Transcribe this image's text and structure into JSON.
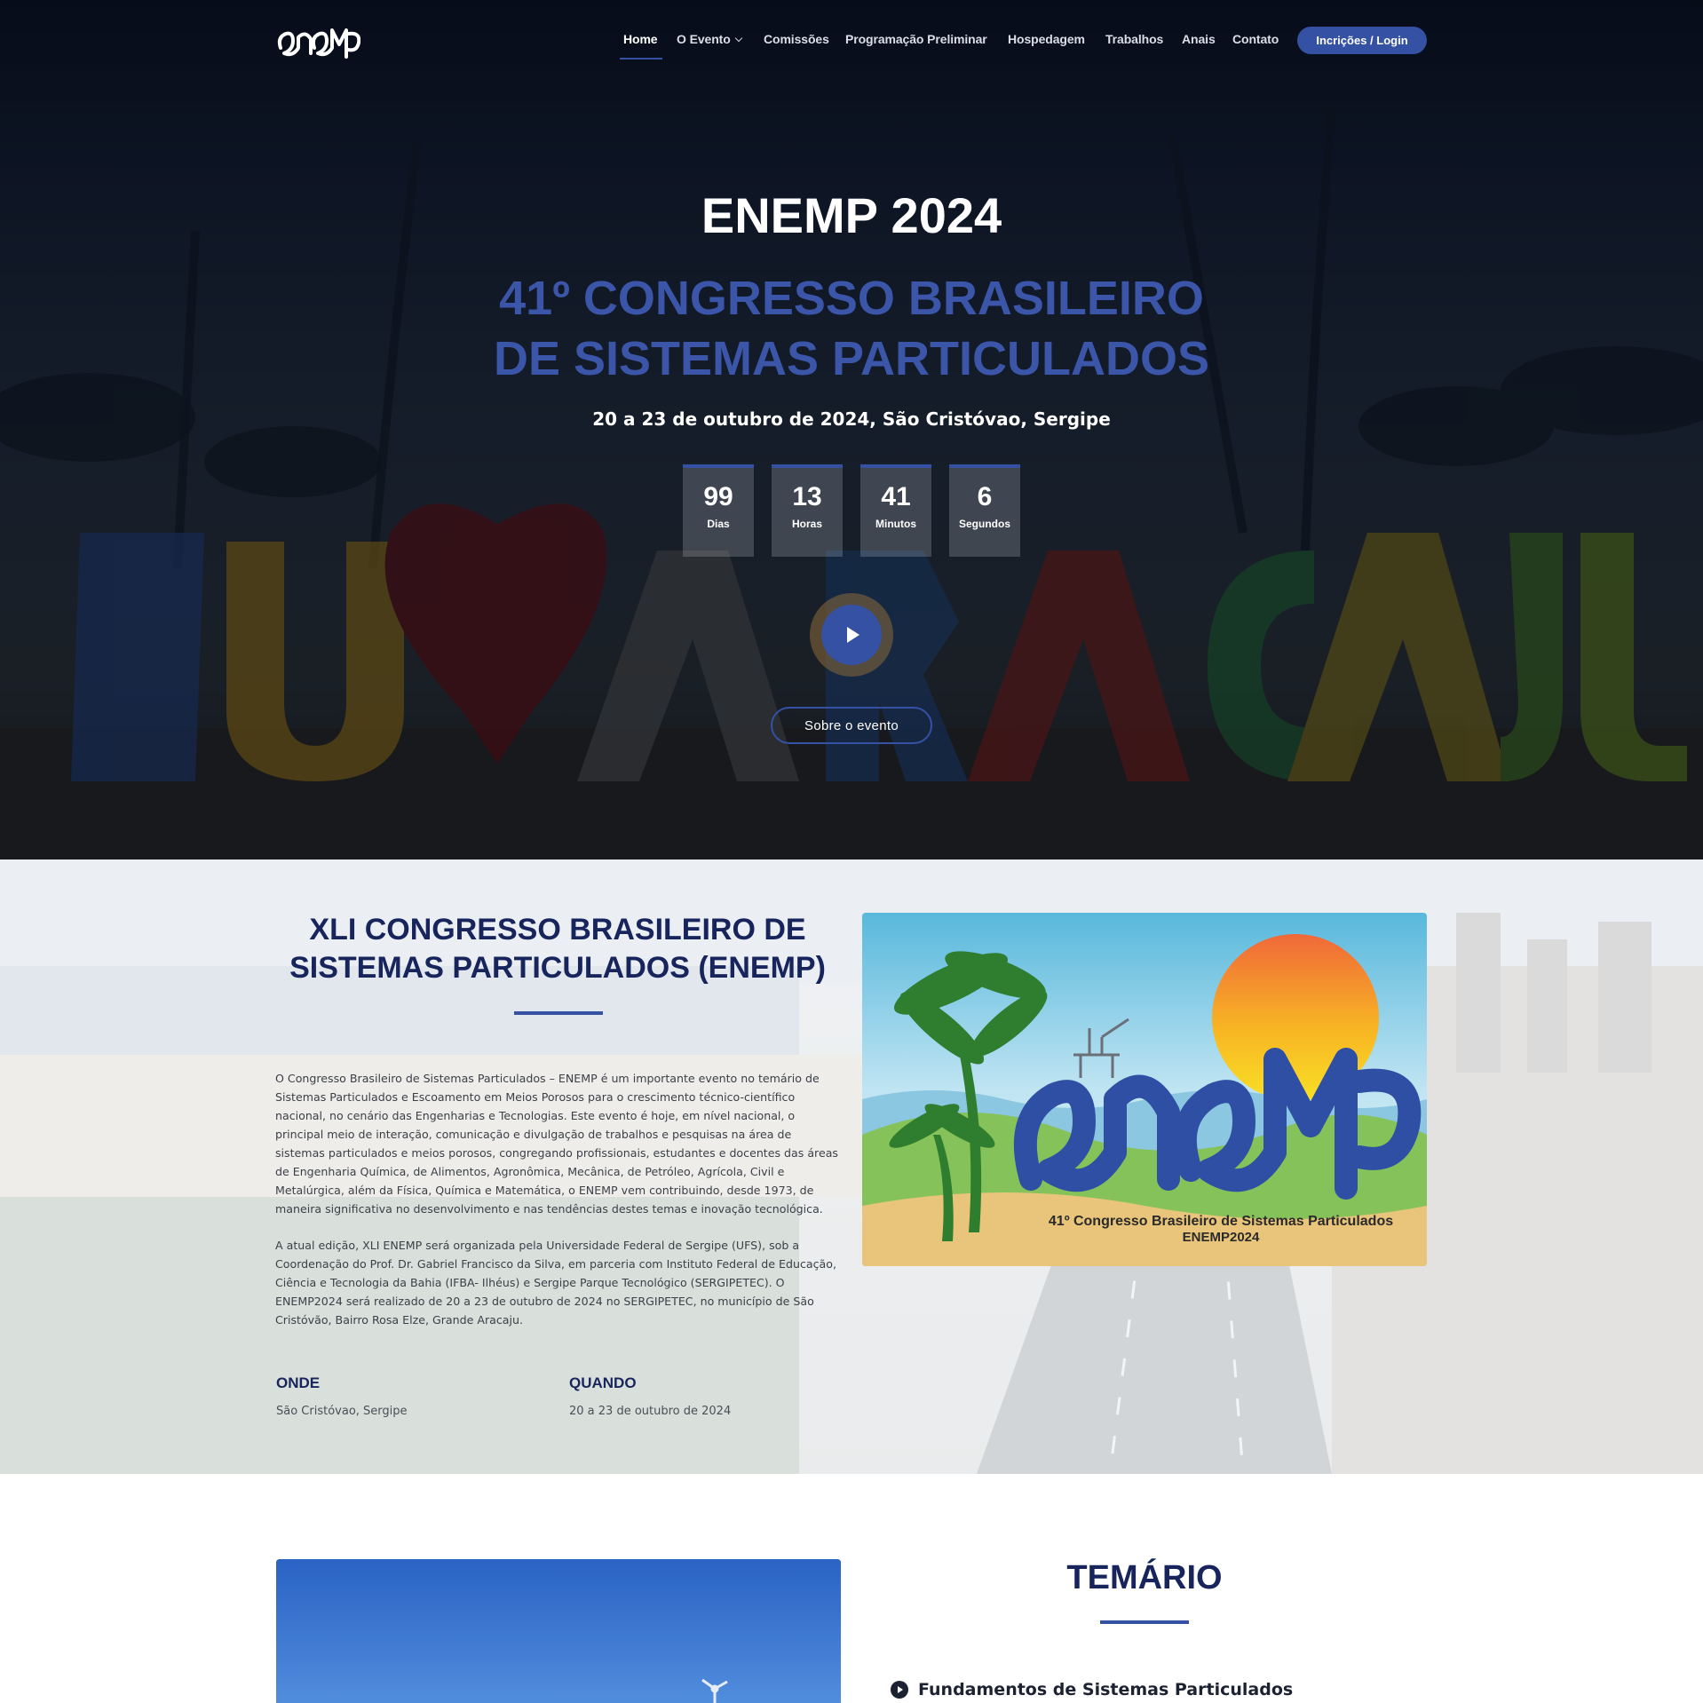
{
  "nav": {
    "logo_text": "enemp",
    "items": [
      {
        "label": "Home"
      },
      {
        "label": "O Evento"
      },
      {
        "label": "Comissões"
      },
      {
        "label": "Programação Preliminar"
      },
      {
        "label": "Hospedagem"
      },
      {
        "label": "Trabalhos"
      },
      {
        "label": "Anais"
      },
      {
        "label": "Contato"
      }
    ],
    "login_label": "Incrições / Login"
  },
  "hero": {
    "title": "ENEMP 2024",
    "subtitle_line1": "41º CONGRESSO BRASILEIRO",
    "subtitle_line2": "DE SISTEMAS PARTICULADOS",
    "date_place": "20 a 23 de outubro de 2024, São Cristóvao, Sergipe",
    "background_sign_text": "EU ARACAJU",
    "countdown": [
      {
        "value": "99",
        "label": "Dias"
      },
      {
        "value": "13",
        "label": "Horas"
      },
      {
        "value": "41",
        "label": "Minutos"
      },
      {
        "value": "6",
        "label": "Segundos"
      }
    ],
    "about_button": "Sobre o evento"
  },
  "about": {
    "heading_line1": "XLI CONGRESSO BRASILEIRO DE",
    "heading_line2": "SISTEMAS PARTICULADOS (ENEMP)",
    "paragraph1": "O Congresso Brasileiro de Sistemas Particulados – ENEMP é um importante evento no temário de Sistemas Particulados e Escoamento em Meios Porosos para o crescimento técnico-científico nacional, no cenário das Engenharias e Tecnologias. Este evento é hoje, em nível nacional, o principal meio de interação, comunicação e divulgação de trabalhos e pesquisas na área de sistemas particulados e meios porosos, congregando profissionais, estudantes e docentes das áreas de Engenharia Química, de Alimentos, Agronômica, Mecânica, de Petróleo, Agrícola, Civil e Metalúrgica, além da Física, Química e Matemática, o ENEMP vem contribuindo, desde 1973, de maneira significativa no desenvolvimento e nas tendências destes temas e inovação tecnológica.",
    "paragraph2": "A atual edição, XLI ENEMP será organizada pela Universidade Federal de Sergipe (UFS), sob a Coordenação do Prof. Dr. Gabriel Francisco da Silva, em parceria com Instituto Federal de Educação, Ciência e Tecnologia da Bahia (IFBA- Ilhéus) e Sergipe Parque Tecnológico (SERGIPETEC). O ENEMP2024 será realizado de 20 a 23 de outubro de 2024 no SERGIPETEC, no município de São Cristóvão, Bairro Rosa Elze, Grande Aracaju.",
    "where_label": "ONDE",
    "where_value": "São Cristóvao, Sergipe",
    "when_label": "QUANDO",
    "when_value": "20 a 23 de outubro de 2024",
    "poster_logo": "enemp",
    "poster_caption1": "41º Congresso Brasileiro de Sistemas Particulados",
    "poster_caption2": "ENEMP2024"
  },
  "temario": {
    "heading": "TEMÁRIO",
    "items": [
      "Fundamentos de Sistemas Particulados"
    ]
  },
  "colors": {
    "accent": "#3451a3",
    "heading_dark": "#17255c"
  }
}
